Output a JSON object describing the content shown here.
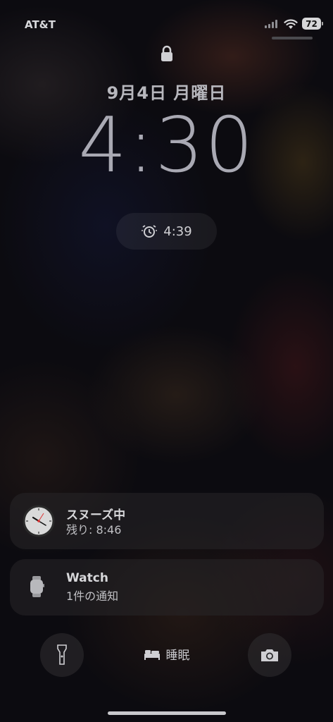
{
  "status_bar": {
    "carrier": "AT&T",
    "battery_level": "72"
  },
  "lock_screen": {
    "date": "9月4日 月曜日",
    "time": "4:30",
    "alarm_time": "4:39"
  },
  "notifications": [
    {
      "title": "スヌーズ中",
      "subtitle": "残り: 8:46",
      "icon": "clock-icon"
    },
    {
      "title": "Watch",
      "subtitle": "1件の通知",
      "icon": "watch-icon"
    }
  ],
  "bottom_bar": {
    "sleep_label": "睡眠"
  },
  "colors": {
    "background": "#0c0b10",
    "text": "#cfcfd3"
  }
}
